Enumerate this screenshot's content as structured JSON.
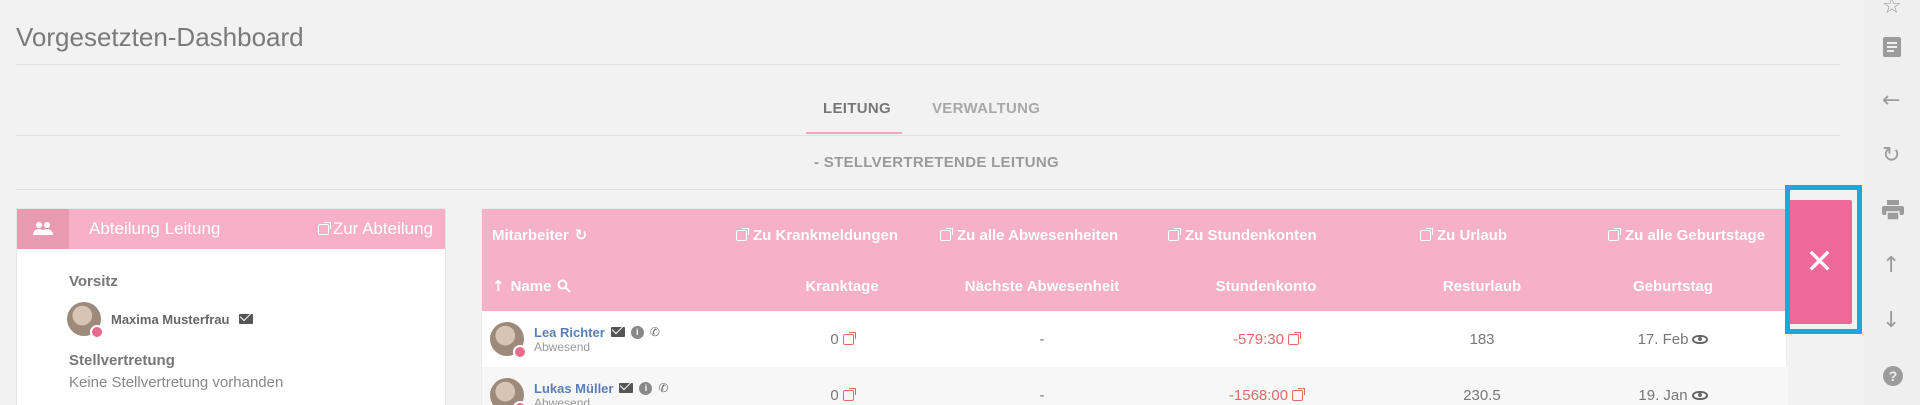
{
  "page": {
    "title": "Vorgesetzten-Dashboard"
  },
  "tabs": [
    {
      "label": "LEITUNG",
      "active": true
    },
    {
      "label": "VERWALTUNG",
      "active": false
    }
  ],
  "subtitle": "- STELLVERTRETENDE LEITUNG",
  "department_card": {
    "title": "Abteilung Leitung",
    "link": "Zur Abteilung",
    "chair_label": "Vorsitz",
    "chair_name": "Maxima Musterfrau",
    "deputy_label": "Stellvertretung",
    "deputy_text": "Keine Stellvertretung vorhanden"
  },
  "table": {
    "header_links": {
      "employees": "Mitarbeiter",
      "sick": "Zu Krankmeldungen",
      "absences": "Zu alle Abwesenheiten",
      "hours": "Zu Stundenkonten",
      "vacation": "Zu Urlaub",
      "birthdays": "Zu alle Geburtstage"
    },
    "columns": {
      "name": "Name",
      "sick_days": "Kranktage",
      "next_absence": "Nächste Abwesenheit",
      "hours": "Stundenkonto",
      "vacation_left": "Resturlaub",
      "birthday": "Geburtstag"
    },
    "rows": [
      {
        "name": "Lea Richter",
        "status": "Abwesend",
        "sick_days": "0",
        "next_absence": "-",
        "hours": "-579:30",
        "vacation_left": "183",
        "birthday": "17. Feb"
      },
      {
        "name": "Lukas Müller",
        "status": "Abwesend",
        "sick_days": "0",
        "next_absence": "-",
        "hours": "-1568:00",
        "vacation_left": "230.5",
        "birthday": "19. Jan"
      }
    ]
  },
  "close_button": {
    "symbol": "✕"
  },
  "rail_icons": [
    "star-icon",
    "notes-icon",
    "back-arrow-icon",
    "reload-icon",
    "print-icon",
    "up-arrow-icon",
    "down-arrow-icon",
    "help-icon"
  ],
  "colors": {
    "accent_pink": "#f6b0c7",
    "close_pink": "#f06898",
    "highlight_blue": "#1aa7e2",
    "negative_red": "#e06a6a"
  }
}
